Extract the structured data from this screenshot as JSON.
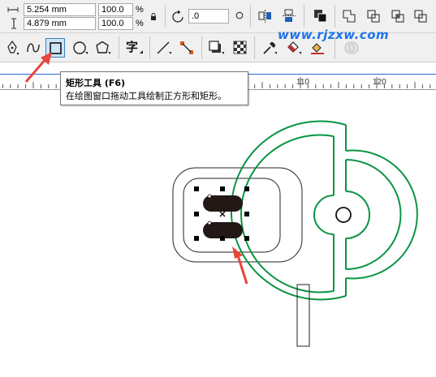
{
  "property_bar": {
    "width_value": "5.254 mm",
    "height_value": "4.879 mm",
    "scale_x": "100.0",
    "scale_y": "100.0",
    "scale_unit": "%",
    "rotation_value": ".0"
  },
  "toolbox": {
    "tools": [
      "pen-tool",
      "bspline-tool",
      "rectangle-tool",
      "ellipse-tool",
      "polygon-tool",
      "text-tool",
      "connector-tool",
      "dimension-tool",
      "drop-shadow-tool",
      "transparency-tool",
      "color-eyedropper-tool",
      "interactive-fill-tool",
      "smart-fill-tool"
    ],
    "text_tool_glyph": "字",
    "active_tool": "rectangle-tool"
  },
  "ruler": {
    "ticks": [
      "110",
      "120"
    ]
  },
  "tooltip": {
    "title": "矩形工具 (F6)",
    "description": "在绘图窗口拖动工具绘制正方形和矩形。"
  },
  "watermark": {
    "text": "www.rjzxw.com"
  },
  "colors": {
    "accent_green": "#0a9444",
    "selection_fill": "#231815",
    "arrow_red": "#e8453c",
    "watermark_blue": "#1e73e8",
    "toolbar_bg": "#f0f0f0"
  }
}
